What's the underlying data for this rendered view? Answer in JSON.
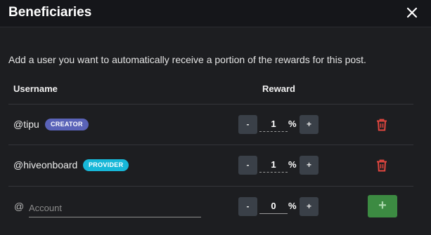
{
  "dialog": {
    "title": "Beneficiaries",
    "description": "Add a user you want to automatically receive a portion of the rewards for this post."
  },
  "table": {
    "col_username": "Username",
    "col_reward": "Reward"
  },
  "rows": [
    {
      "username": "@tipu",
      "badge": "CREATOR",
      "badge_color": "#5a63b8",
      "reward": "1",
      "unit": "%"
    },
    {
      "username": "@hiveonboard",
      "badge": "PROVIDER",
      "badge_color": "#17b7d8",
      "reward": "1",
      "unit": "%"
    }
  ],
  "new_entry": {
    "at_symbol": "@",
    "placeholder": "Account",
    "reward": "0",
    "unit": "%"
  },
  "controls": {
    "minus": "-",
    "plus": "+",
    "add": "+"
  },
  "icons": {
    "close": "close-icon",
    "delete": "trash-icon"
  },
  "colors": {
    "delete": "#e0463f",
    "add_button": "#3c8b42"
  }
}
